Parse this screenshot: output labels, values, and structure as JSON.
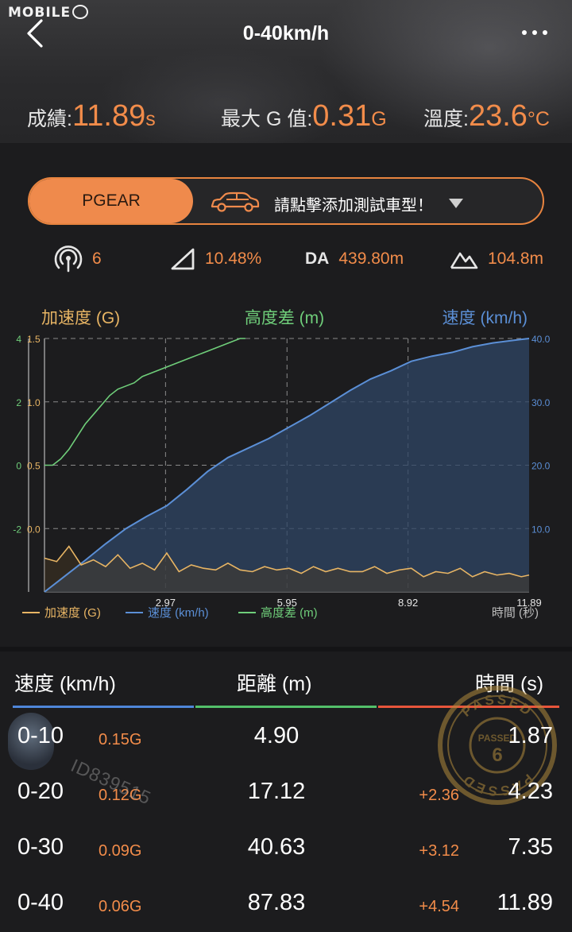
{
  "watermark": "MOBILE",
  "header": {
    "title": "0-40km/h",
    "stats": {
      "result": {
        "label": "成績:",
        "value": "11.89",
        "unit": "s"
      },
      "max_g": {
        "label": "最大 G 值:",
        "value": "0.31",
        "unit": "G"
      },
      "temperature": {
        "label": "溫度:",
        "value": "23.6",
        "unit": "°C"
      }
    }
  },
  "pgear": {
    "button_label": "PGEAR",
    "prompt": "請點擊添加測試車型！"
  },
  "info": {
    "satellites": "6",
    "slope": "10.48%",
    "da_label": "DA",
    "da_value": "439.80m",
    "altitude": "104.8m"
  },
  "chart_data": {
    "type": "line",
    "titles": {
      "left": "加速度 (G)",
      "middle": "高度差 (m)",
      "right": "速度 (km/h)"
    },
    "xlabel": "時間 (秒)",
    "x_ticks": [
      "2.97",
      "5.95",
      "8.92",
      "11.89"
    ],
    "x_range": [
      0,
      11.89
    ],
    "left_axis_outer_ticks": [
      "4",
      "2",
      "0",
      "-2"
    ],
    "left_axis_inner_ticks": [
      "1.5",
      "1.0",
      "0.5",
      "0.0"
    ],
    "right_axis_ticks": [
      "40.0",
      "30.0",
      "20.0",
      "10.0"
    ],
    "speed_range": [
      0,
      40
    ],
    "accel_range": [
      0,
      1.5
    ],
    "height_range": [
      -4,
      4
    ],
    "grid": true,
    "legend": [
      "加速度 (G)",
      "速度 (km/h)",
      "高度差 (m)"
    ],
    "colors": {
      "accel": "#e8b564",
      "speed": "#5b8fd6",
      "height": "#6fce7a"
    },
    "series": [
      {
        "name": "速度 (km/h)",
        "x": [
          0,
          0.3,
          0.6,
          1.0,
          1.5,
          2.0,
          2.5,
          3.0,
          3.5,
          4.0,
          4.5,
          5.0,
          5.5,
          6.0,
          6.5,
          7.0,
          7.5,
          8.0,
          8.5,
          9.0,
          9.5,
          10.0,
          10.5,
          11.0,
          11.5,
          11.89
        ],
        "values": [
          0,
          1.5,
          3.0,
          5.0,
          7.6,
          10.0,
          11.9,
          13.6,
          16.2,
          19.0,
          21.2,
          22.7,
          24.2,
          26.0,
          27.8,
          29.8,
          31.8,
          33.6,
          34.9,
          36.4,
          37.2,
          37.8,
          38.7,
          39.3,
          39.7,
          40.0
        ]
      },
      {
        "name": "加速度 (G)",
        "x": [
          0,
          0.3,
          0.6,
          0.9,
          1.2,
          1.5,
          1.8,
          2.1,
          2.4,
          2.7,
          3.0,
          3.3,
          3.6,
          3.9,
          4.2,
          4.5,
          4.8,
          5.1,
          5.4,
          5.7,
          6.0,
          6.3,
          6.6,
          6.9,
          7.2,
          7.5,
          7.8,
          8.1,
          8.4,
          8.7,
          9.0,
          9.3,
          9.6,
          9.9,
          10.2,
          10.5,
          10.8,
          11.1,
          11.4,
          11.7,
          11.89
        ],
        "values": [
          0.2,
          0.18,
          0.27,
          0.16,
          0.19,
          0.15,
          0.22,
          0.14,
          0.17,
          0.13,
          0.23,
          0.12,
          0.16,
          0.14,
          0.13,
          0.17,
          0.13,
          0.12,
          0.15,
          0.13,
          0.14,
          0.11,
          0.15,
          0.12,
          0.14,
          0.12,
          0.12,
          0.15,
          0.11,
          0.13,
          0.14,
          0.09,
          0.12,
          0.11,
          0.14,
          0.09,
          0.12,
          0.1,
          0.11,
          0.09,
          0.1
        ]
      },
      {
        "name": "高度差 (m)",
        "x": [
          0,
          0.2,
          0.4,
          0.6,
          0.8,
          1.0,
          1.2,
          1.4,
          1.6,
          1.8,
          2.0,
          2.2,
          2.4,
          2.6,
          2.8,
          3.0,
          3.2,
          3.4,
          3.6,
          3.8,
          4.0,
          4.2,
          4.4,
          4.6,
          4.8,
          4.93
        ],
        "values": [
          0,
          0,
          0.2,
          0.5,
          0.9,
          1.3,
          1.6,
          1.9,
          2.2,
          2.4,
          2.5,
          2.6,
          2.8,
          2.9,
          3.0,
          3.1,
          3.2,
          3.3,
          3.4,
          3.5,
          3.6,
          3.7,
          3.8,
          3.9,
          4.0,
          4.0
        ]
      }
    ]
  },
  "table": {
    "headers": {
      "speed": "速度 (km/h)",
      "distance": "距離 (m)",
      "time": "時間 (s)"
    },
    "header_colors": {
      "speed": "#4f86d9",
      "distance": "#53c06a",
      "time": "#e8553b"
    },
    "rows": [
      {
        "speed": "0-10",
        "g": "0.15G",
        "distance": "4.90",
        "diff": "",
        "time": "1.87"
      },
      {
        "speed": "0-20",
        "g": "0.12G",
        "distance": "17.12",
        "diff": "+2.36",
        "time": "4.23"
      },
      {
        "speed": "0-30",
        "g": "0.09G",
        "distance": "40.63",
        "diff": "+3.12",
        "time": "7.35"
      },
      {
        "speed": "0-40",
        "g": "0.06G",
        "distance": "87.83",
        "diff": "+4.54",
        "time": "11.89"
      }
    ],
    "id_watermark": "ID839515",
    "stamp": {
      "text_top": "PASSED",
      "number": "6"
    }
  }
}
